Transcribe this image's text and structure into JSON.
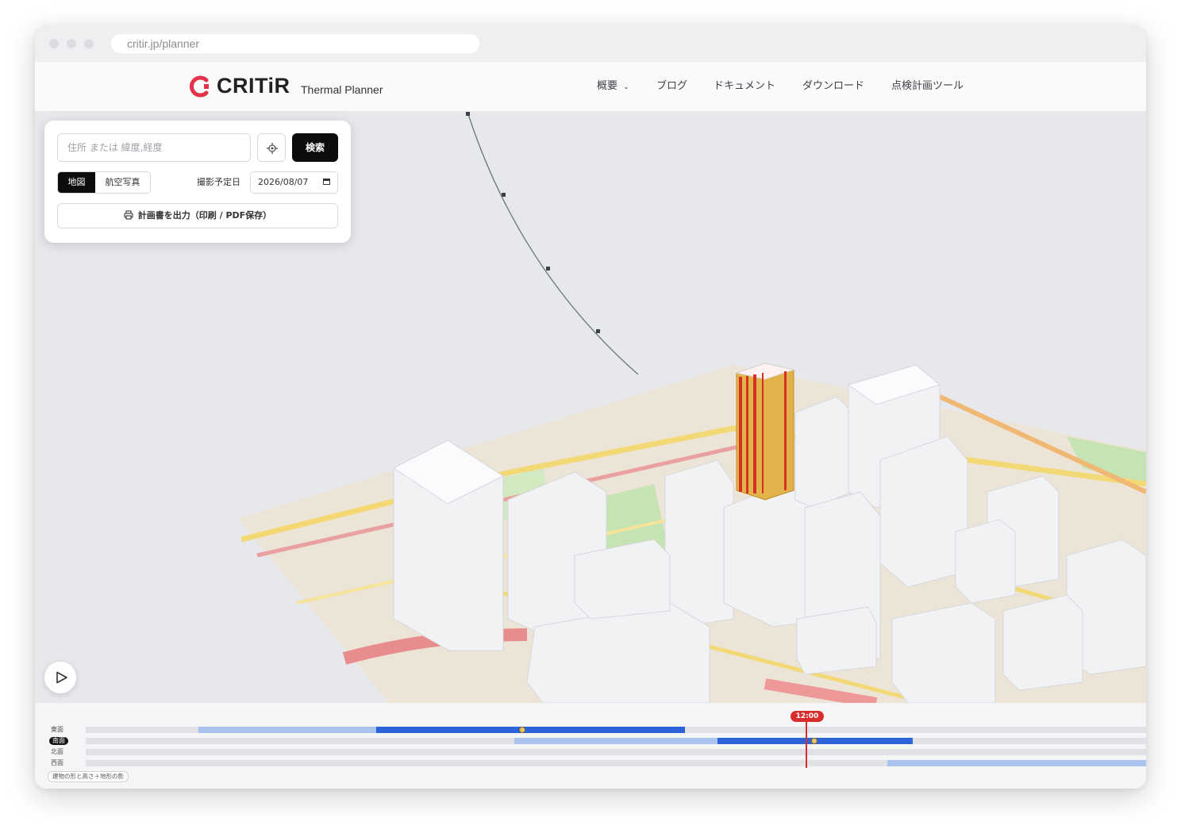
{
  "browser": {
    "url": "critir.jp/planner"
  },
  "header": {
    "brand": "CRITiR",
    "subtitle": "Thermal Planner",
    "brand_color": "#e3324b",
    "nav": [
      {
        "label": "概要",
        "has_dropdown": true
      },
      {
        "label": "ブログ"
      },
      {
        "label": "ドキュメント"
      },
      {
        "label": "ダウンロード"
      },
      {
        "label": "点検計画ツール"
      }
    ]
  },
  "panel": {
    "search_placeholder": "住所 または 緯度,経度",
    "search_button": "検索",
    "map_type_options": [
      "地図",
      "航空写真"
    ],
    "map_type_selected": "地図",
    "date_label": "撮影予定日",
    "date_value": "2026/08/07",
    "export_button": "計画書を出力（印刷 / PDF保存）"
  },
  "timeline": {
    "rows": [
      {
        "label": "東面",
        "active": false
      },
      {
        "label": "南面",
        "active": true
      },
      {
        "label": "北面",
        "active": false
      },
      {
        "label": "西面",
        "active": false
      }
    ],
    "current_time": "12:00",
    "mode_tag": "建物の形と高さ＋地形の影",
    "accent_color": "#d92c2c",
    "sun_color": "#2d62d8"
  }
}
